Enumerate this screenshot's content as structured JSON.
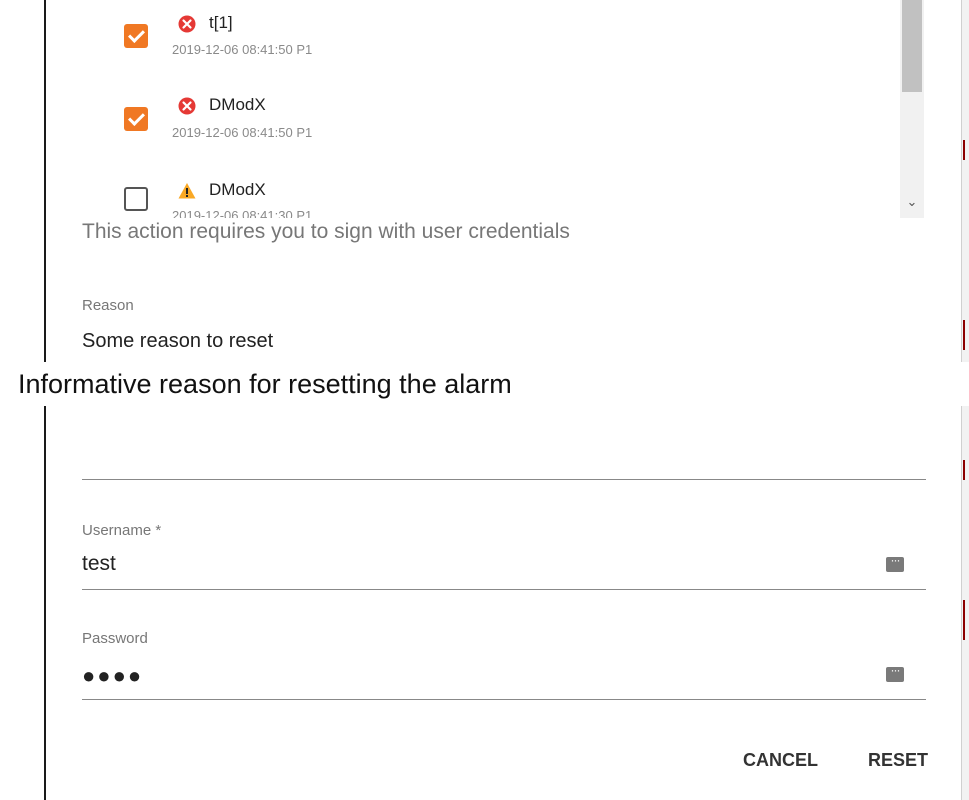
{
  "alarms": [
    {
      "name": "t[1]",
      "meta": "2019-12-06 08:41:50 P1",
      "checked": true,
      "severity": "error"
    },
    {
      "name": "DModX",
      "meta": "2019-12-06 08:41:50 P1",
      "checked": true,
      "severity": "error"
    },
    {
      "name": "DModX",
      "meta": "2019-12-06 08:41:30 P1",
      "checked": false,
      "severity": "warning"
    }
  ],
  "form": {
    "notice": "This action requires you to sign with user credentials",
    "reason_label": "Reason",
    "reason_value": "Some reason to reset",
    "reason_tooltip": "Informative reason for resetting the alarm",
    "username_label": "Username *",
    "username_value": "test",
    "password_label": "Password",
    "password_value": "●●●●"
  },
  "actions": {
    "cancel_label": "CANCEL",
    "reset_label": "RESET"
  },
  "colors": {
    "accent": "#f07823",
    "error": "#e53935",
    "warning": "#f9a825"
  }
}
